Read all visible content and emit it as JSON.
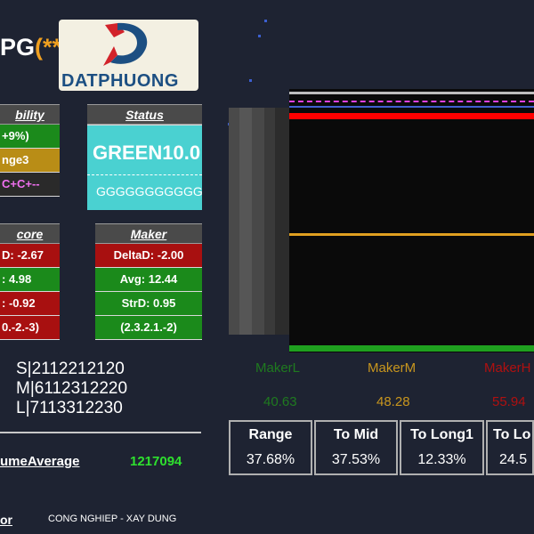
{
  "ticker": {
    "symbol": "PG",
    "suffix": "(**"
  },
  "logo": {
    "name": "DATPHUONG"
  },
  "stability_tile": {
    "title": "bility",
    "rows": [
      "+9%)",
      "nge3",
      "C+C+--"
    ]
  },
  "status_tile": {
    "title": "Status",
    "main": "GREEN10.0",
    "sub": "GGGGGGGGGGG"
  },
  "score_tile": {
    "title": "core",
    "rows": [
      "D: -2.67",
      ": 4.98",
      ": -0.92",
      "0.-2.-3)"
    ]
  },
  "maker_tile": {
    "title": "Maker",
    "rows": [
      "DeltaD: -2.00",
      "Avg: 12.44",
      "StrD: 0.95",
      "(2.3.2.1.-2)"
    ]
  },
  "codes": [
    "S|2112212120",
    "M|6112312220",
    "L|7113312230"
  ],
  "volume": {
    "label": "umeAverage",
    "value": "1217094"
  },
  "sector": {
    "label": "or",
    "value": "CONG NGHIEP - XAY DUNG"
  },
  "makers": [
    {
      "label": "MakerL",
      "value": "40.63",
      "color": "#1f7a1f"
    },
    {
      "label": "MakerM",
      "value": "48.28",
      "color": "#c8961e"
    },
    {
      "label": "MakerH",
      "value": "55.94",
      "color": "#b01010"
    }
  ],
  "boxes": [
    {
      "head": "Range",
      "value": "37.68%"
    },
    {
      "head": "To Mid",
      "value": "37.53%"
    },
    {
      "head": "To Long1",
      "value": "12.33%"
    },
    {
      "head": "To Lo",
      "value": "24.5"
    }
  ],
  "colors": {
    "green": "#1b8a1b",
    "red": "#a81010",
    "yellow": "#b98d16",
    "cyan": "#4ad1d1",
    "accent_orange": "#f0a020",
    "chart_red": "#ff0000",
    "chart_gold": "#e0a020",
    "chart_green": "#1fa01f",
    "chart_magenta": "#e040e0"
  }
}
